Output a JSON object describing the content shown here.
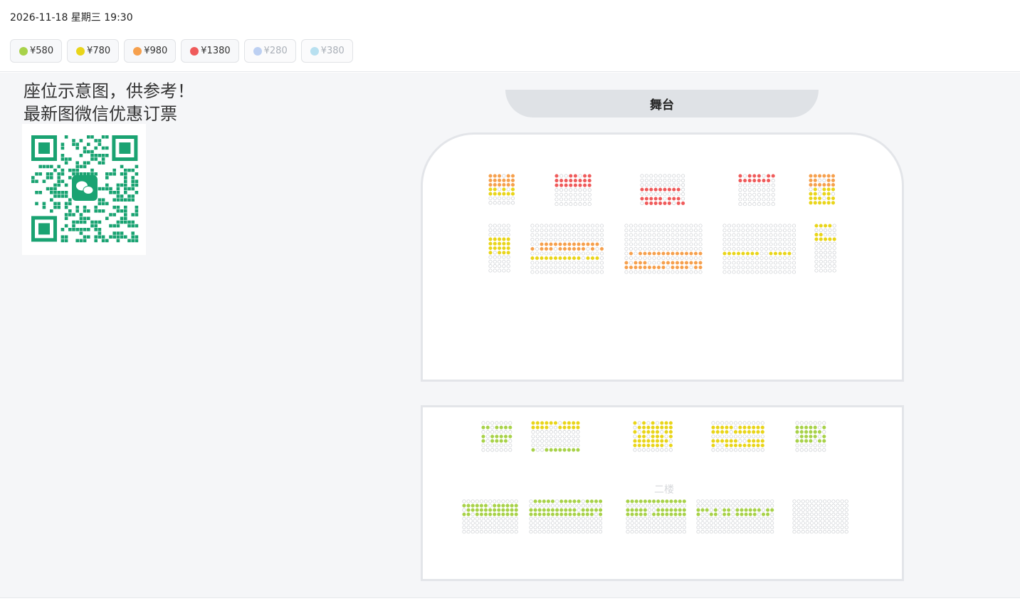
{
  "header": {
    "datetime": "2026-11-18 星期三 19:30"
  },
  "prices": [
    {
      "label": "¥580",
      "color": "#a8d24a",
      "enabled": true
    },
    {
      "label": "¥780",
      "color": "#e9d51a",
      "enabled": true
    },
    {
      "label": "¥980",
      "color": "#f6a04d",
      "enabled": true
    },
    {
      "label": "¥1380",
      "color": "#ef5b5b",
      "enabled": true
    },
    {
      "label": "¥280",
      "color": "#bdd0f2",
      "enabled": false
    },
    {
      "label": "¥380",
      "color": "#b8e0f0",
      "enabled": false
    }
  ],
  "notice": {
    "line1": "座位示意图，供参考！",
    "line2": "最新图微信优惠订票"
  },
  "qr": {
    "icon": "wechat-icon",
    "color": "#1aa372"
  },
  "stage": {
    "label": "舞台"
  },
  "floor2": {
    "label": "二楼"
  }
}
